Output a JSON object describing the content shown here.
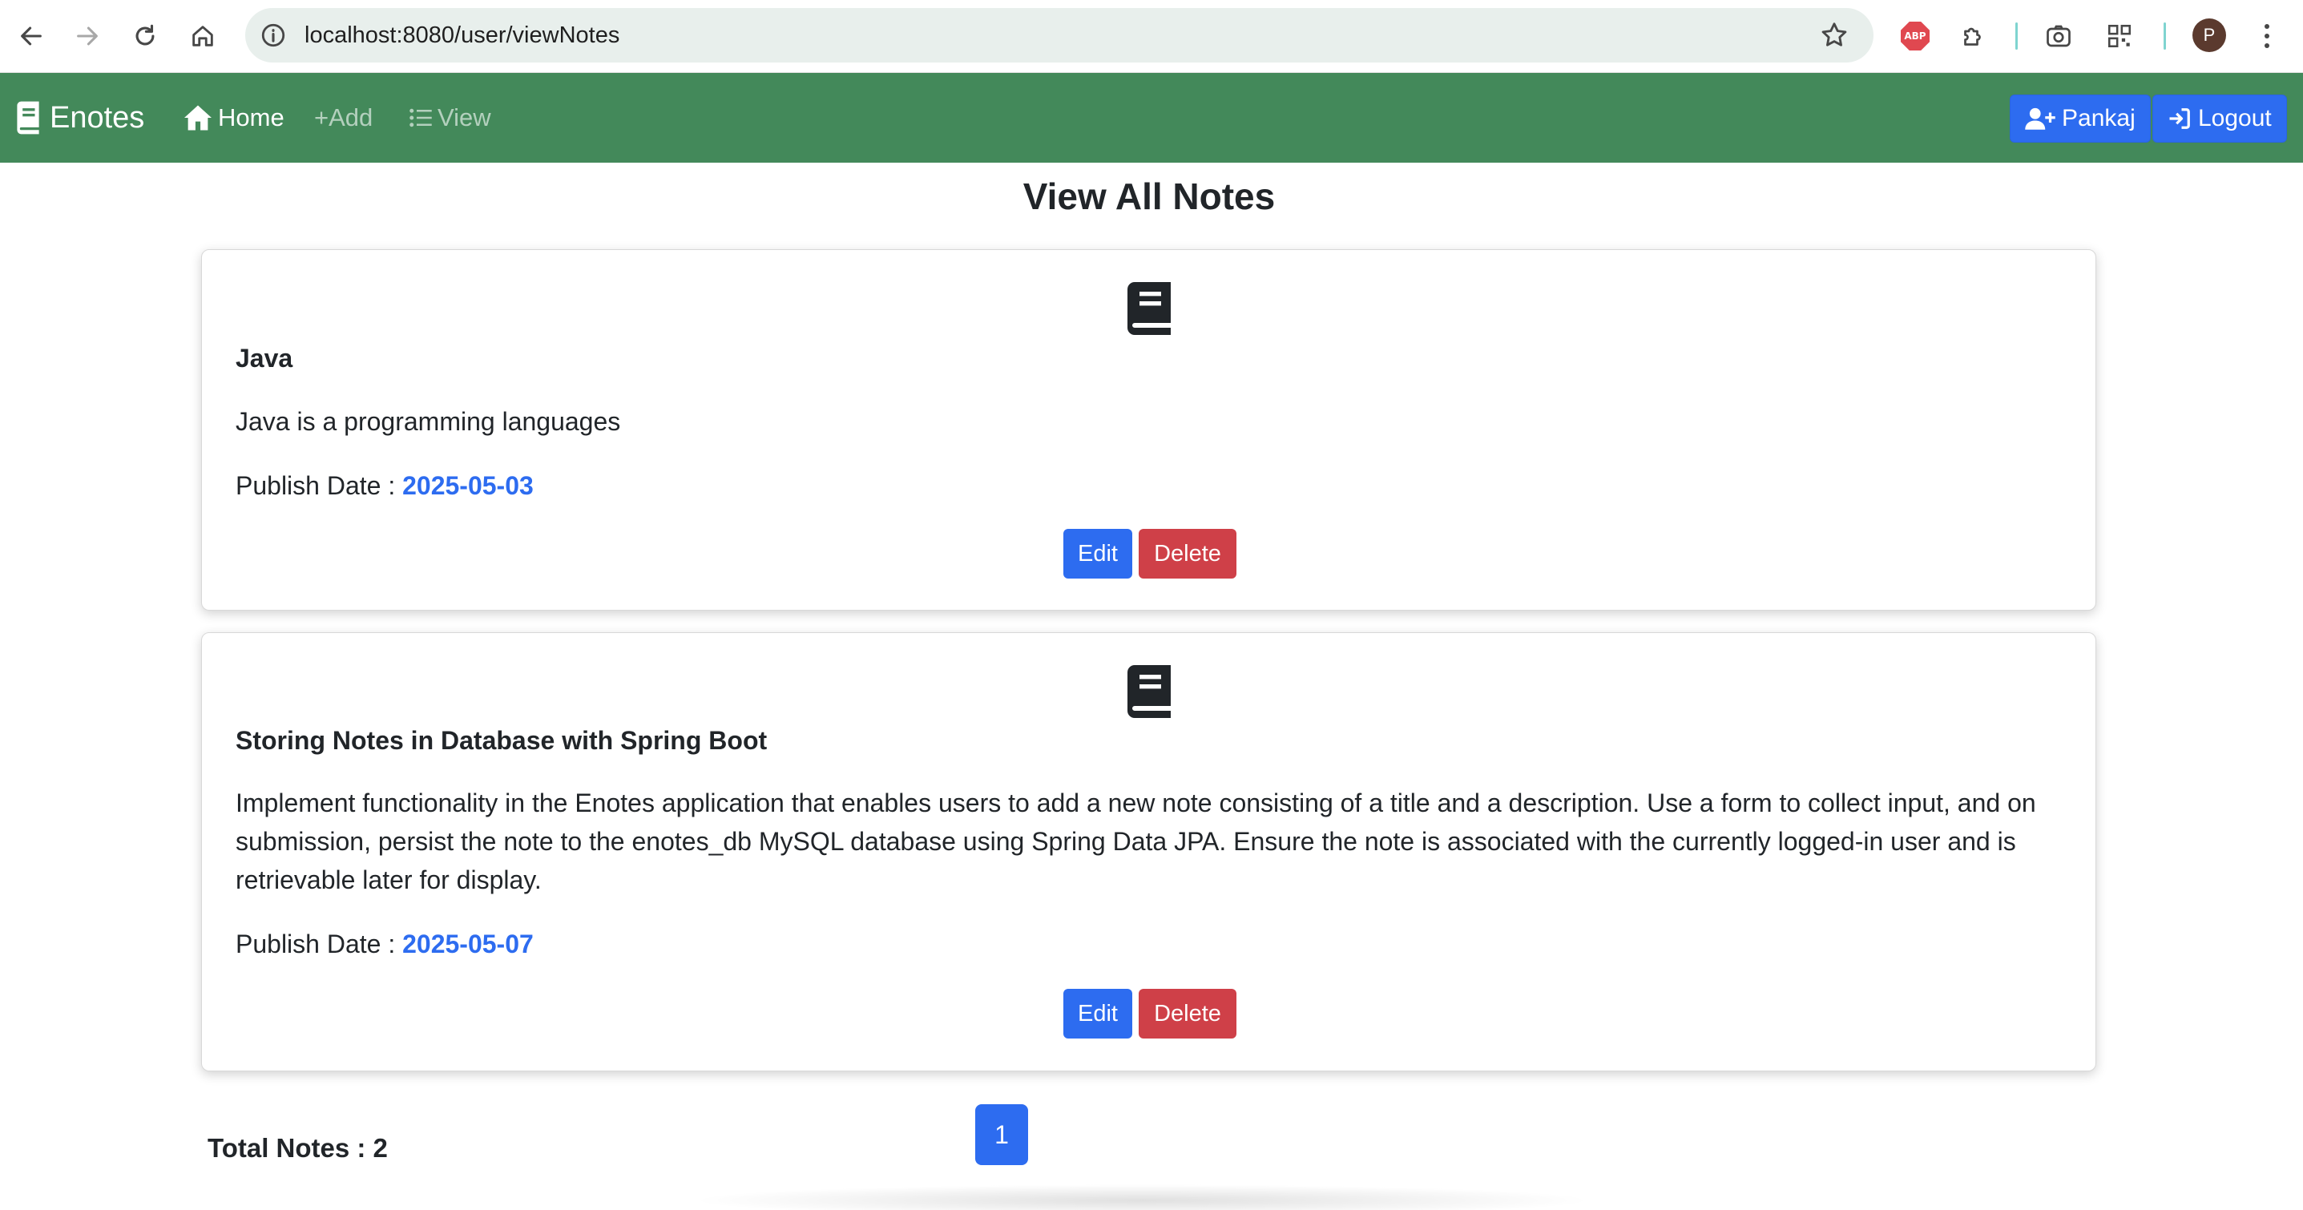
{
  "browser": {
    "url": "localhost:8080/user/viewNotes",
    "profile_initial": "P",
    "extension_abp_label": "ABP"
  },
  "navbar": {
    "brand": "Enotes",
    "links": [
      {
        "label": "Home",
        "icon": "home-icon",
        "active": true
      },
      {
        "label": "+Add",
        "icon": "plus-icon",
        "active": false
      },
      {
        "label": "View",
        "icon": "list-icon",
        "active": false
      }
    ],
    "user_button": "Pankaj",
    "logout_button": "Logout",
    "colors": {
      "navbar_bg": "#43895a",
      "primary": "#2d6cf0",
      "danger": "#cf4048"
    }
  },
  "page": {
    "title": "View All Notes",
    "date_label": "Publish Date : ",
    "notes": [
      {
        "title": "Java",
        "description": "Java is a programming languages",
        "publish_date": "2025-05-03",
        "edit_label": "Edit",
        "delete_label": "Delete"
      },
      {
        "title": "Storing Notes in Database with Spring Boot",
        "description": "Implement functionality in the Enotes application that enables users to add a new note consisting of a title and a description. Use a form to collect input, and on submission, persist the note to the enotes_db MySQL database using Spring Data JPA. Ensure the note is associated with the currently logged-in user and is retrievable later for display.",
        "publish_date": "2025-05-07",
        "edit_label": "Edit",
        "delete_label": "Delete"
      }
    ],
    "pagination": {
      "current_page": "1"
    },
    "total_notes": "Total Notes : 2"
  }
}
